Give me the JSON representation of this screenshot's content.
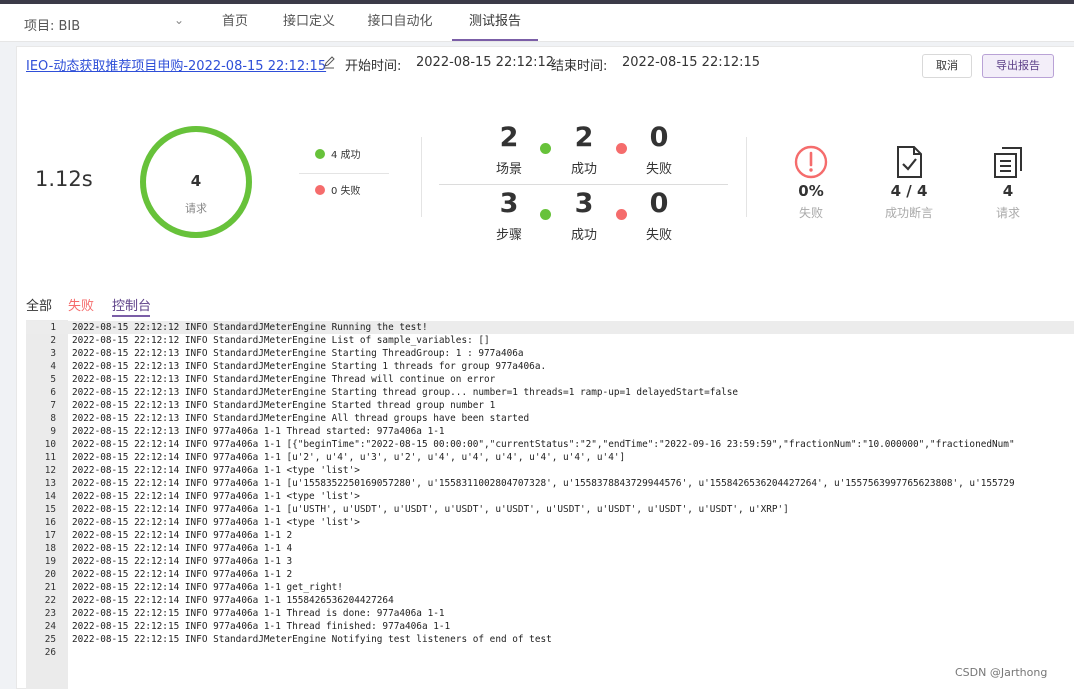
{
  "project_label": "项目: BIB",
  "nav": [
    "首页",
    "接口定义",
    "接口自动化",
    "测试报告"
  ],
  "report": {
    "title": "IEO-动态获取推荐项目申购-2022-08-15 22:12:15",
    "start_label": "开始时间:",
    "start_value": "2022-08-15 22:12:12",
    "end_label": "结束时间:",
    "end_value": "2022-08-15 22:12:15",
    "cancel": "取消",
    "export": "导出报告"
  },
  "summary": {
    "duration": "1.12s",
    "requests": "4",
    "requests_label": "请求",
    "success_legend": "4 成功",
    "fail_legend": "0 失败",
    "success_fraction": 1.0
  },
  "scenarios": {
    "total": "2",
    "total_label": "场景",
    "success": "2",
    "success_label": "成功",
    "fail": "0",
    "fail_label": "失败"
  },
  "steps": {
    "total": "3",
    "total_label": "步骤",
    "success": "3",
    "success_label": "成功",
    "fail": "0",
    "fail_label": "失败"
  },
  "kpis": {
    "fail_rate": "0%",
    "fail_rate_label": "失败",
    "assert": "4 / 4",
    "assert_label": "成功断言",
    "req": "4",
    "req_label": "请求"
  },
  "colors": {
    "accent": "#7b5ea7",
    "success": "#67c23a",
    "fail": "#f56c6c",
    "link": "#2f4fd8"
  },
  "subtabs": [
    "全部",
    "失败",
    "控制台"
  ],
  "console_lines": [
    "2022-08-15 22:12:12 INFO StandardJMeterEngine Running the test!",
    "2022-08-15 22:12:12 INFO StandardJMeterEngine List of sample_variables: []",
    "2022-08-15 22:12:13 INFO StandardJMeterEngine Starting ThreadGroup: 1 : 977a406a",
    "2022-08-15 22:12:13 INFO StandardJMeterEngine Starting 1 threads for group 977a406a.",
    "2022-08-15 22:12:13 INFO StandardJMeterEngine Thread will continue on error",
    "2022-08-15 22:12:13 INFO StandardJMeterEngine Starting thread group... number=1 threads=1 ramp-up=1 delayedStart=false",
    "2022-08-15 22:12:13 INFO StandardJMeterEngine Started thread group number 1",
    "2022-08-15 22:12:13 INFO StandardJMeterEngine All thread groups have been started",
    "2022-08-15 22:12:13 INFO 977a406a 1-1 Thread started: 977a406a 1-1",
    "2022-08-15 22:12:14 INFO 977a406a 1-1 [{\"beginTime\":\"2022-08-15 00:00:00\",\"currentStatus\":\"2\",\"endTime\":\"2022-09-16 23:59:59\",\"fractionNum\":\"10.000000\",\"fractionedNum\"",
    "2022-08-15 22:12:14 INFO 977a406a 1-1 [u'2', u'4', u'3', u'2', u'4', u'4', u'4', u'4', u'4', u'4']",
    "2022-08-15 22:12:14 INFO 977a406a 1-1 <type 'list'>",
    "2022-08-15 22:12:14 INFO 977a406a 1-1 [u'1558352250169057280', u'1558311002804707328', u'1558378843729944576', u'1558426536204427264', u'1557563997765623808', u'155729",
    "2022-08-15 22:12:14 INFO 977a406a 1-1 <type 'list'>",
    "2022-08-15 22:12:14 INFO 977a406a 1-1 [u'USTH', u'USDT', u'USDT', u'USDT', u'USDT', u'USDT', u'USDT', u'USDT', u'USDT', u'XRP']",
    "2022-08-15 22:12:14 INFO 977a406a 1-1 <type 'list'>",
    "2022-08-15 22:12:14 INFO 977a406a 1-1 2",
    "2022-08-15 22:12:14 INFO 977a406a 1-1 4",
    "2022-08-15 22:12:14 INFO 977a406a 1-1 3",
    "2022-08-15 22:12:14 INFO 977a406a 1-1 2",
    "2022-08-15 22:12:14 INFO 977a406a 1-1 get_right!",
    "2022-08-15 22:12:14 INFO 977a406a 1-1 1558426536204427264",
    "2022-08-15 22:12:15 INFO 977a406a 1-1 Thread is done: 977a406a 1-1",
    "2022-08-15 22:12:15 INFO 977a406a 1-1 Thread finished: 977a406a 1-1",
    "2022-08-15 22:12:15 INFO StandardJMeterEngine Notifying test listeners of end of test",
    ""
  ],
  "watermark": "CSDN @Jarthong"
}
